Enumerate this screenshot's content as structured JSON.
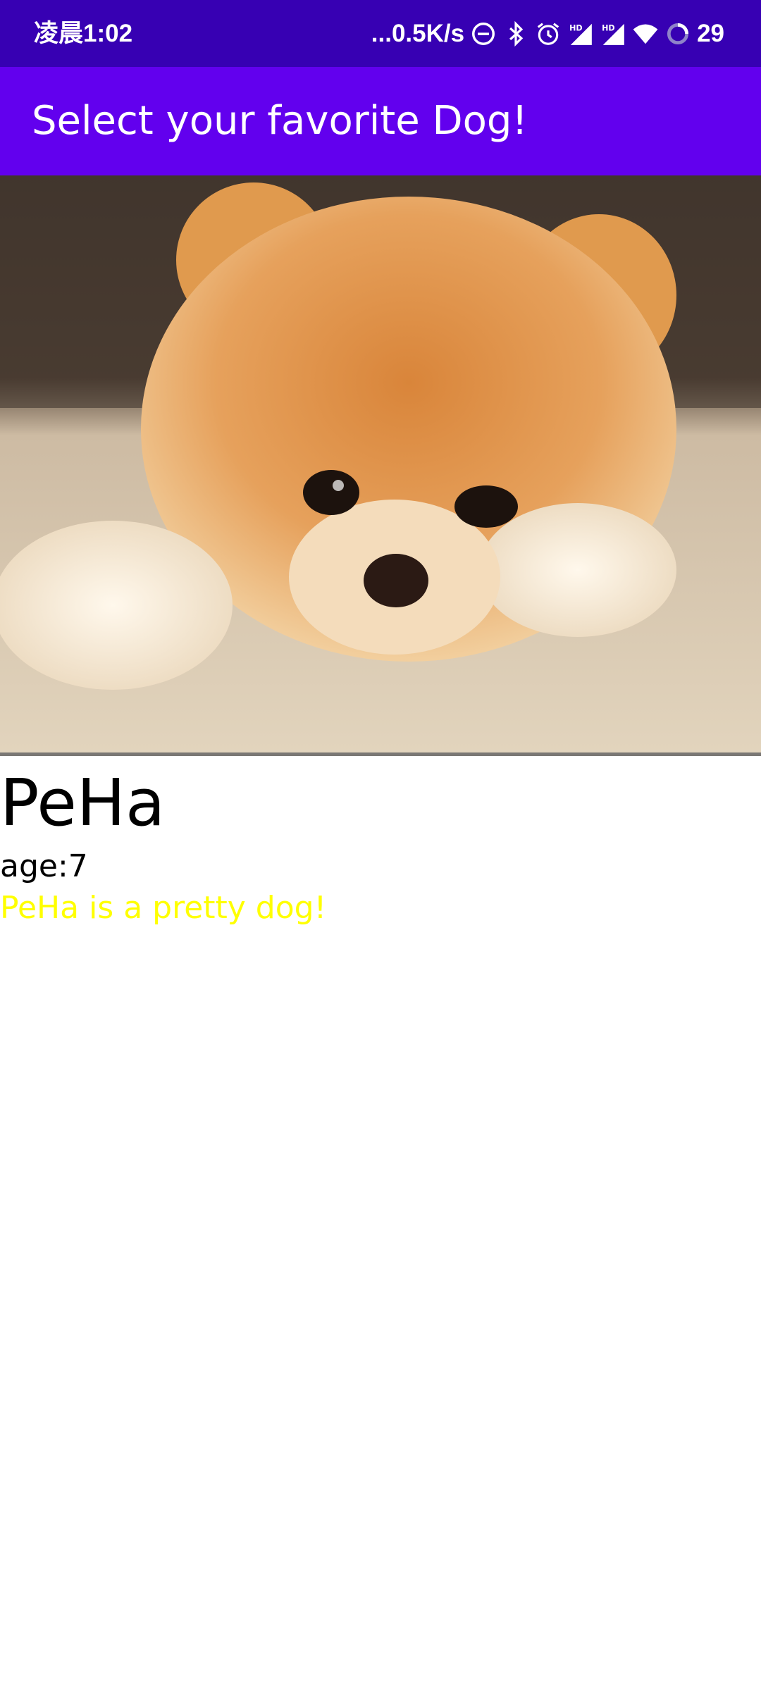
{
  "status_bar": {
    "time": "凌晨1:02",
    "network_speed": "...0.5K/s",
    "battery": "29",
    "icons": [
      "dnd-icon",
      "bluetooth-icon",
      "alarm-icon",
      "hd-signal-icon",
      "hd-signal-icon",
      "wifi-icon",
      "battery-icon"
    ]
  },
  "app_bar": {
    "title": "Select your favorite Dog!",
    "color": "#6200ee"
  },
  "dog": {
    "image_alt": "Pomeranian puppy",
    "name": "PeHa",
    "age": "age:7",
    "description": "PeHa is a pretty dog!",
    "description_color": "#ffff00"
  }
}
